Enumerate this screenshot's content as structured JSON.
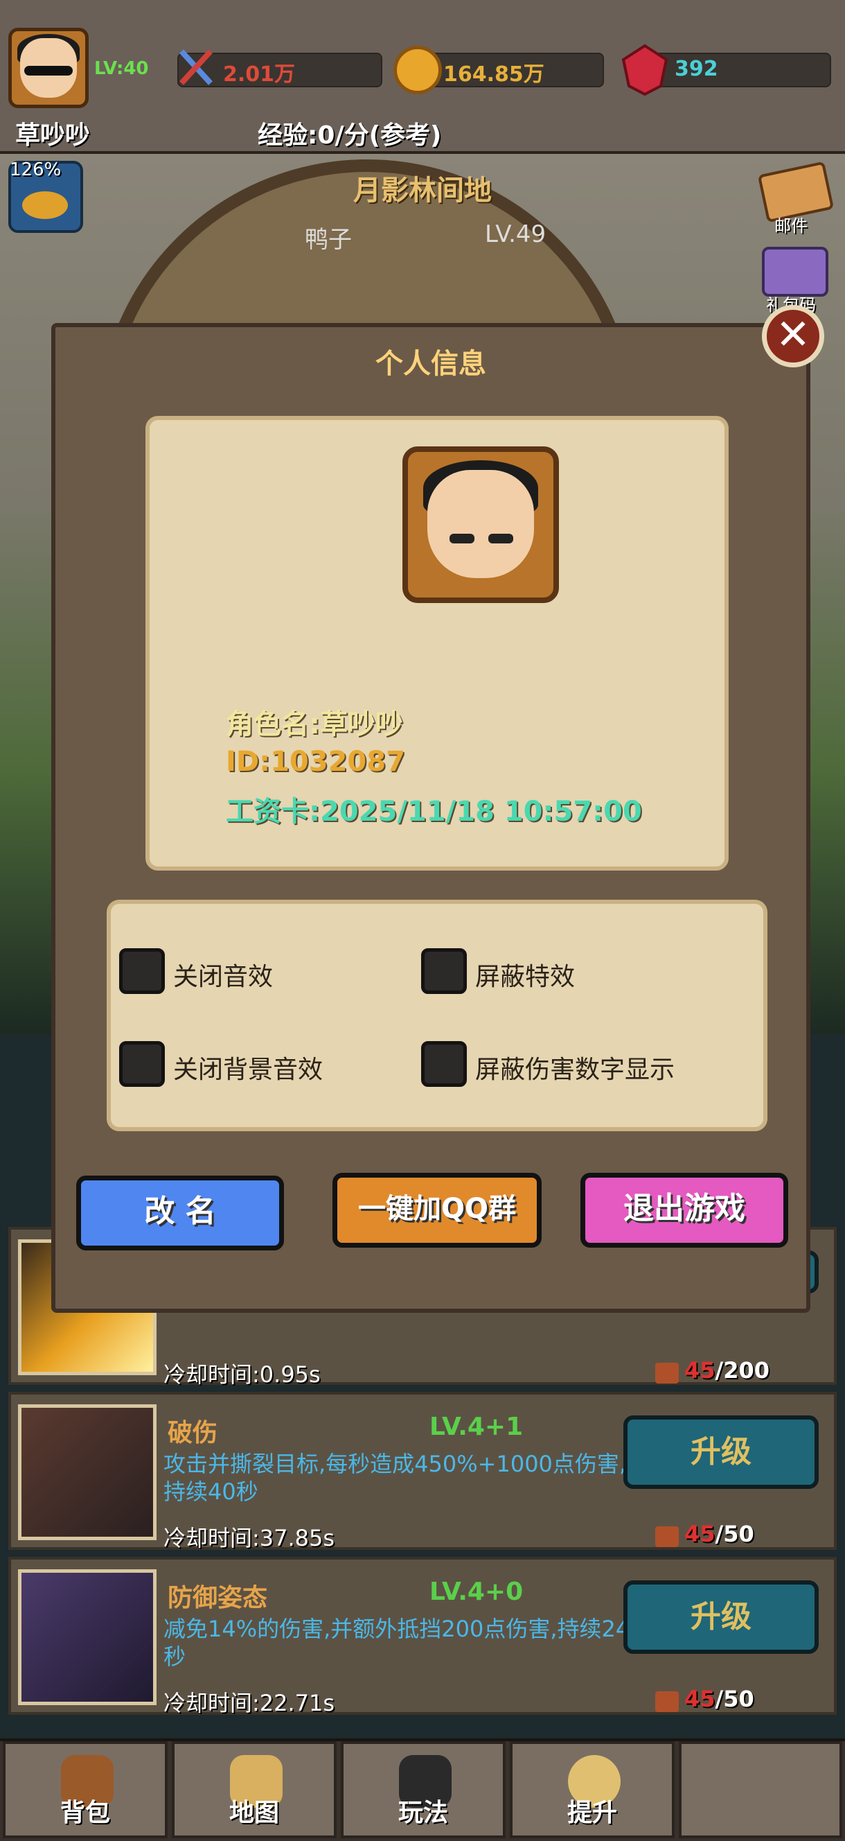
{
  "top": {
    "level": "LV:40",
    "power": "2.01万",
    "gold": "164.85万",
    "gems": "392",
    "player_name": "草吵吵",
    "exp_rate": "经验:0/分(参考)",
    "exp_bonus": "126%"
  },
  "scene": {
    "map_name": "月影林间地",
    "enemy_name": "鸭子",
    "enemy_level": "LV.49"
  },
  "side_menu": {
    "mail_label": "邮件",
    "gift_label": "礼包码"
  },
  "modal": {
    "title": "个人信息",
    "role_name": "角色名:草吵吵",
    "id": "ID:1032087",
    "salary_card": "工资卡:2025/11/18 10:57:00",
    "settings": [
      {
        "label": "关闭音效"
      },
      {
        "label": "屏蔽特效"
      },
      {
        "label": "关闭背景音效"
      },
      {
        "label": "屏蔽伤害数字显示"
      }
    ],
    "buttons": {
      "rename": "改 名",
      "join_qq": "一键加QQ群",
      "exit": "退出游戏"
    }
  },
  "skills": [
    {
      "name": "",
      "level": "",
      "desc": "",
      "cooldown": "冷却时间:0.95s",
      "cost_have": "45",
      "cost_need": "/200",
      "button": ""
    },
    {
      "name": "破伤",
      "level": "LV.4+1",
      "desc": "攻击并撕裂目标,每秒造成450%+1000点伤害,持续40秒",
      "cooldown": "冷却时间:37.85s",
      "cost_have": "45",
      "cost_need": "/50",
      "button": "升级"
    },
    {
      "name": "防御姿态",
      "level": "LV.4+0",
      "desc": "减免14%的伤害,并额外抵挡200点伤害,持续24秒",
      "cooldown": "冷却时间:22.71s",
      "cost_have": "45",
      "cost_need": "/50",
      "button": "升级"
    }
  ],
  "nav": [
    {
      "label": "背包"
    },
    {
      "label": "地图"
    },
    {
      "label": "玩法"
    },
    {
      "label": "提升"
    },
    {
      "label": ""
    }
  ],
  "colors": {
    "rename_btn": "#4f86f0",
    "qq_btn": "#e08a2c",
    "exit_btn": "#e45ac0",
    "upgrade_btn": "#1f6678",
    "cost_insufficient": "#e03030"
  }
}
